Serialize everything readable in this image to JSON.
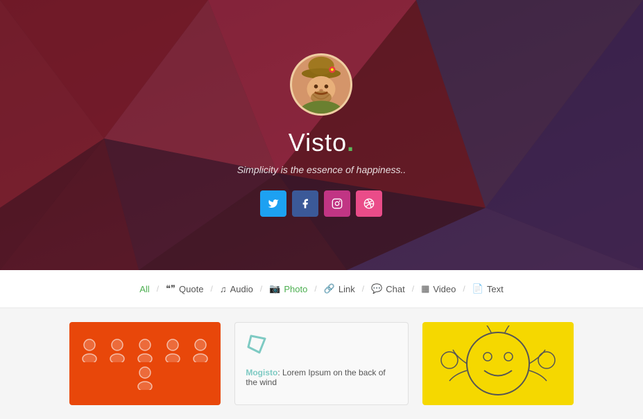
{
  "hero": {
    "avatar_emoji": "🧙",
    "name": "Visto",
    "dot": ".",
    "tagline": "Simplicity is the essence of happiness..",
    "social": [
      {
        "name": "twitter",
        "label": "Twitter",
        "icon": "𝕏",
        "class": "twitter"
      },
      {
        "name": "facebook",
        "label": "Facebook",
        "icon": "f",
        "class": "facebook"
      },
      {
        "name": "instagram",
        "label": "Instagram",
        "icon": "📷",
        "class": "instagram"
      },
      {
        "name": "dribbble",
        "label": "Dribbble",
        "icon": "⚽",
        "class": "dribbble"
      }
    ]
  },
  "nav": {
    "items": [
      {
        "label": "All",
        "icon": "",
        "active": true
      },
      {
        "label": "Quote",
        "icon": "❝",
        "active": false
      },
      {
        "label": "Audio",
        "icon": "♫",
        "active": false
      },
      {
        "label": "Photo",
        "icon": "📷",
        "active": false
      },
      {
        "label": "Link",
        "icon": "🔗",
        "active": false
      },
      {
        "label": "Chat",
        "icon": "💬",
        "active": false
      },
      {
        "label": "Video",
        "icon": "▦",
        "active": false
      },
      {
        "label": "Text",
        "icon": "📄",
        "active": false
      }
    ]
  },
  "cards": {
    "card2": {
      "icon": "🔗",
      "author": "Mogisto",
      "text": ": Lorem Ipsum on the back of the wind"
    }
  }
}
